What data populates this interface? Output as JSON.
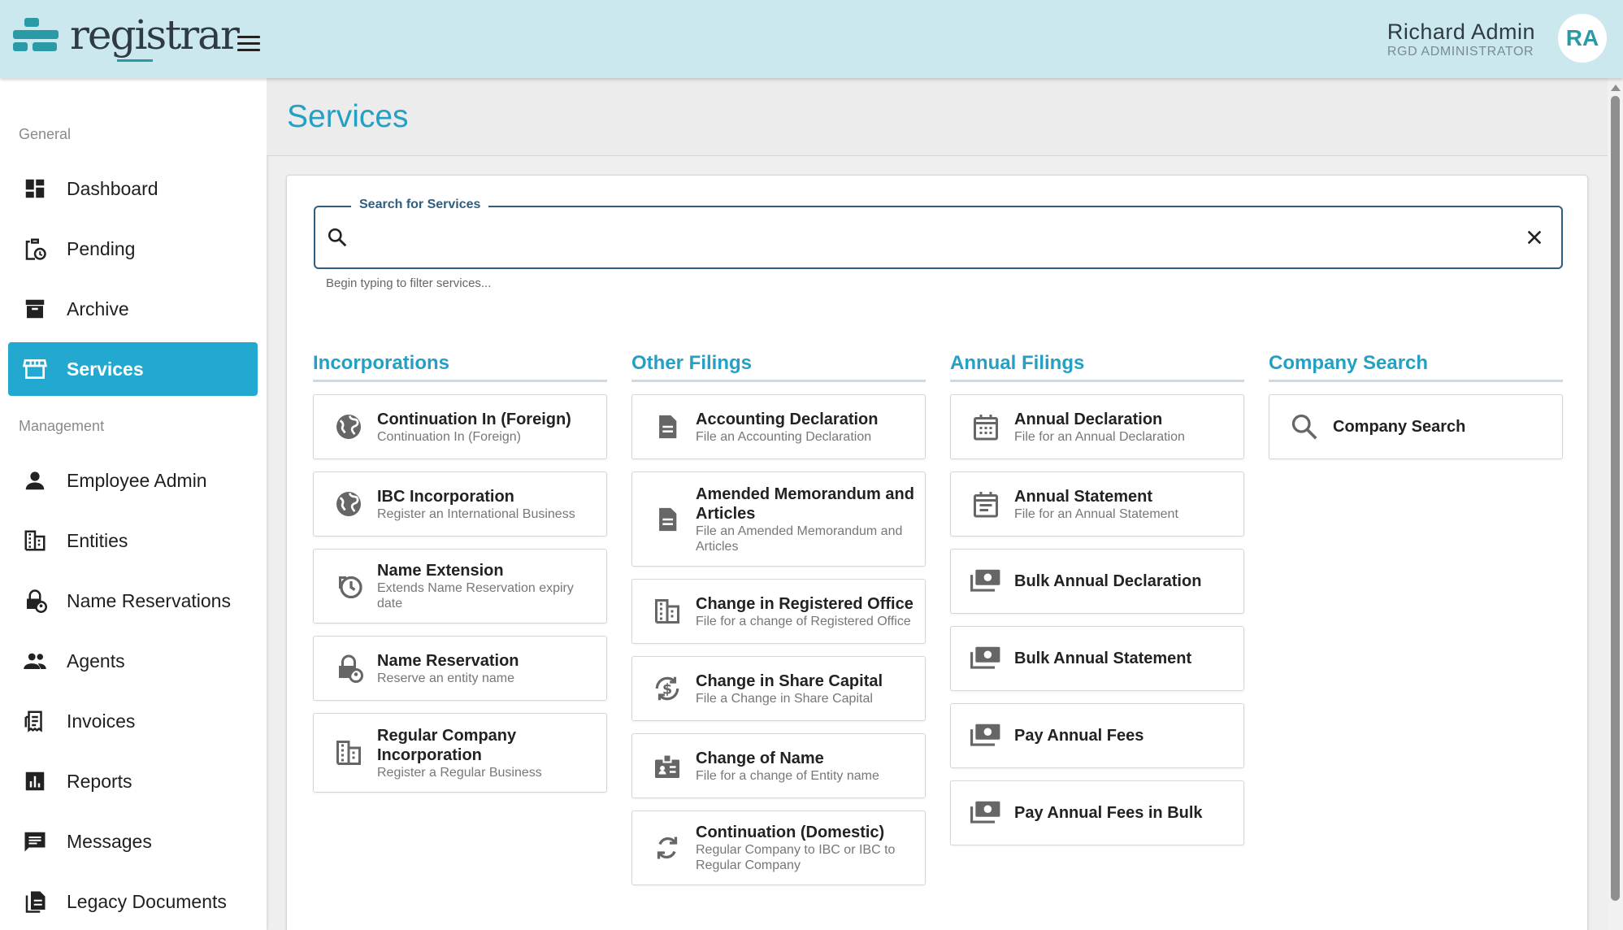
{
  "app": {
    "logo_text": "registrar",
    "user_name": "Richard Admin",
    "user_role": "RGD ADMINISTRATOR",
    "avatar_initials": "RA"
  },
  "sidebar": {
    "section_general": "General",
    "section_management": "Management",
    "items": [
      {
        "label": "Dashboard",
        "icon": "dashboard-icon"
      },
      {
        "label": "Pending",
        "icon": "pending-icon"
      },
      {
        "label": "Archive",
        "icon": "archive-icon"
      },
      {
        "label": "Services",
        "icon": "storefront-icon",
        "active": true
      },
      {
        "label": "Employee Admin",
        "icon": "person-icon"
      },
      {
        "label": "Entities",
        "icon": "building-icon"
      },
      {
        "label": "Name Reservations",
        "icon": "lock-person-icon"
      },
      {
        "label": "Agents",
        "icon": "people-icon"
      },
      {
        "label": "Invoices",
        "icon": "receipt-icon"
      },
      {
        "label": "Reports",
        "icon": "bar-chart-icon"
      },
      {
        "label": "Messages",
        "icon": "message-icon"
      },
      {
        "label": "Legacy Documents",
        "icon": "documents-icon"
      }
    ]
  },
  "page": {
    "title": "Services"
  },
  "search": {
    "legend": "Search for Services",
    "value": "",
    "placeholder": "",
    "helper": "Begin typing to filter services..."
  },
  "columns": [
    {
      "title": "Incorporations",
      "items": [
        {
          "title": "Continuation In (Foreign)",
          "subtitle": "Continuation In (Foreign)",
          "icon": "globe-icon"
        },
        {
          "title": "IBC Incorporation",
          "subtitle": "Register an International Business",
          "icon": "globe-icon"
        },
        {
          "title": "Name Extension",
          "subtitle": "Extends Name Reservation expiry date",
          "icon": "history-clock-icon"
        },
        {
          "title": "Name Reservation",
          "subtitle": "Reserve an entity name",
          "icon": "lock-person-icon"
        },
        {
          "title": "Regular Company Incorporation",
          "subtitle": "Register a Regular Business",
          "icon": "building-icon"
        }
      ]
    },
    {
      "title": "Other Filings",
      "items": [
        {
          "title": "Accounting Declaration",
          "subtitle": "File an Accounting Declaration",
          "icon": "document-icon"
        },
        {
          "title": "Amended Memorandum and Articles",
          "subtitle": "File an Amended Memorandum and Articles",
          "icon": "document-icon"
        },
        {
          "title": "Change in Registered Office",
          "subtitle": "File for a change of Registered Office",
          "icon": "building-icon"
        },
        {
          "title": "Change in Share Capital",
          "subtitle": "File a Change in Share Capital",
          "icon": "currency-exchange-icon"
        },
        {
          "title": "Change of Name",
          "subtitle": "File for a change of Entity name",
          "icon": "badge-icon"
        },
        {
          "title": "Continuation (Domestic)",
          "subtitle": "Regular Company to IBC or IBC to Regular Company",
          "icon": "sync-icon"
        }
      ]
    },
    {
      "title": "Annual Filings",
      "items": [
        {
          "title": "Annual Declaration",
          "subtitle": "File for an Annual Declaration",
          "icon": "calendar-icon"
        },
        {
          "title": "Annual Statement",
          "subtitle": "File for an Annual Statement",
          "icon": "event-note-icon"
        },
        {
          "title": "Bulk Annual Declaration",
          "subtitle": "",
          "icon": "payments-icon"
        },
        {
          "title": "Bulk Annual Statement",
          "subtitle": "",
          "icon": "payments-icon"
        },
        {
          "title": "Pay Annual Fees",
          "subtitle": "",
          "icon": "payments-icon"
        },
        {
          "title": "Pay Annual Fees in Bulk",
          "subtitle": "",
          "icon": "payments-icon"
        }
      ]
    },
    {
      "title": "Company Search",
      "items": [
        {
          "title": "Company Search",
          "subtitle": "",
          "icon": "search-icon"
        }
      ]
    }
  ],
  "colors": {
    "header_bg": "#cce8ef",
    "accent": "#23a0c4",
    "active_nav": "#23a9d0",
    "search_border": "#2e5f80"
  }
}
